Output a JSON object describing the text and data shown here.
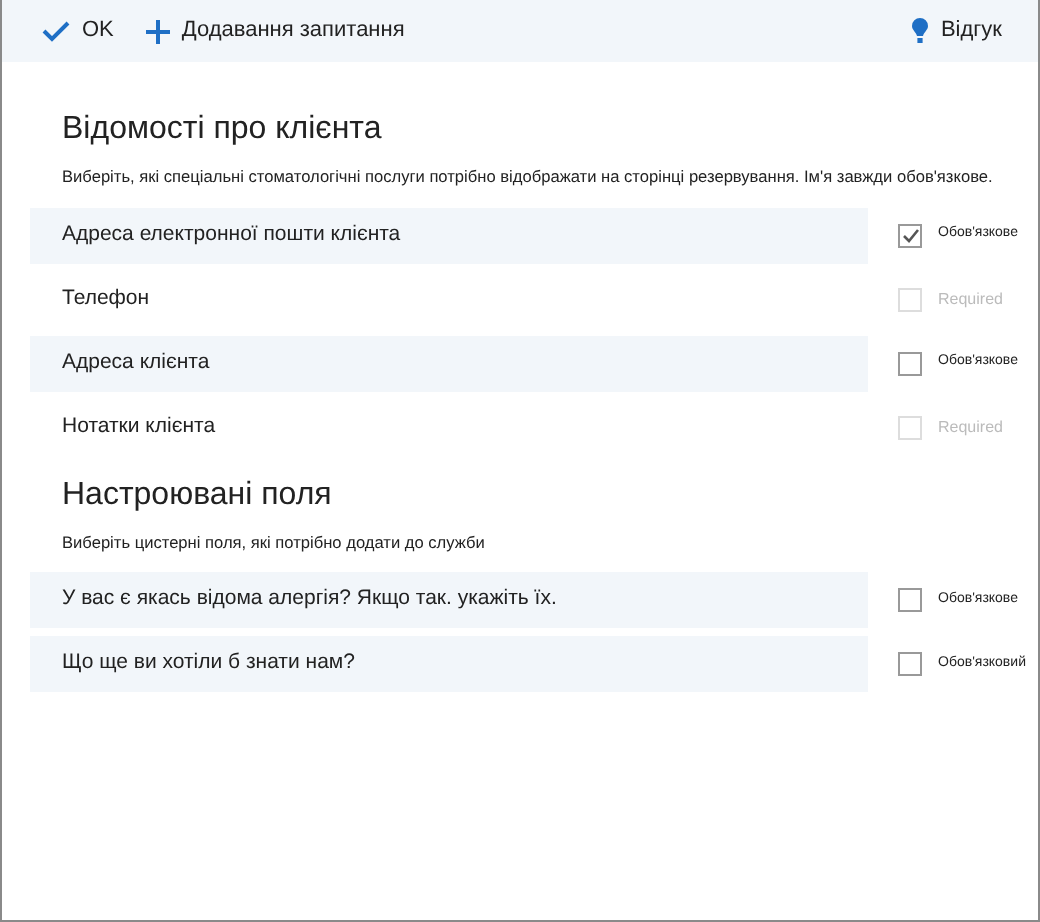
{
  "toolbar": {
    "ok": "OK",
    "add_question": "Додавання запитання",
    "feedback": "Відгук"
  },
  "sections": [
    {
      "title": "Відомості про клієнта",
      "description": "Виберіть, які спеціальні стоматологічні послуги потрібно відображати на сторінці резервування. Ім'я завжди обов'язкове.",
      "fields": [
        {
          "label": "Адреса електронної пошти клієнта",
          "shaded": true,
          "checked": true,
          "disabled": false,
          "required_label": "Обов'язкове"
        },
        {
          "label": "Телефон",
          "shaded": false,
          "checked": false,
          "disabled": true,
          "required_label": "Required"
        },
        {
          "label": "Адреса клієнта",
          "shaded": true,
          "checked": false,
          "disabled": false,
          "required_label": "Обов'язкове"
        },
        {
          "label": "Нотатки клієнта",
          "shaded": false,
          "checked": false,
          "disabled": true,
          "required_label": "Required"
        }
      ]
    },
    {
      "title": "Настроювані поля",
      "description": "Виберіть цистерні поля, які потрібно додати до служби",
      "fields": [
        {
          "label": "У вас є якась відома алергія? Якщо так. укажіть їх.",
          "shaded": true,
          "checked": false,
          "disabled": false,
          "required_label": "Обов'язкове"
        },
        {
          "label": "Що ще ви хотіли б знати нам?",
          "shaded": true,
          "checked": false,
          "disabled": false,
          "required_label": "Обов'язковий"
        }
      ]
    }
  ]
}
